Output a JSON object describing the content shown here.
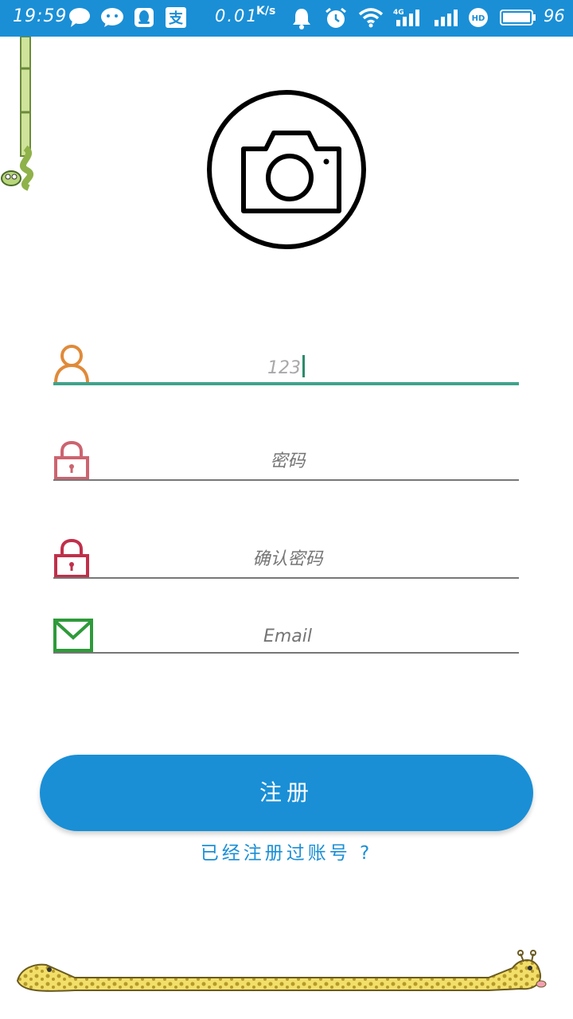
{
  "status_bar": {
    "time": "19:59",
    "net_speed": "0.01",
    "net_speed_unit": "K/s",
    "battery": "96",
    "network": "4G",
    "hd": "HD",
    "apps": [
      "chat-bubble-icon",
      "wechat-icon",
      "qq-icon",
      "alipay-icon"
    ],
    "alipay_glyph": "支"
  },
  "avatar": {
    "icon": "camera-icon"
  },
  "form": {
    "username": {
      "value": "123",
      "icon": "user-icon",
      "color": "#e08a3a"
    },
    "password": {
      "placeholder": "密码",
      "icon": "lock-icon",
      "color": "#cc6470"
    },
    "confirm_password": {
      "placeholder": "确认密码",
      "icon": "lock-icon",
      "color": "#c0304a"
    },
    "email": {
      "placeholder": "Email",
      "icon": "envelope-icon",
      "color": "#2e9a3a"
    }
  },
  "actions": {
    "register_label": "注册",
    "login_link": "已经注册过账号 ?"
  },
  "colors": {
    "primary": "#1a8fd6",
    "focus_underline": "#3fa38a"
  }
}
